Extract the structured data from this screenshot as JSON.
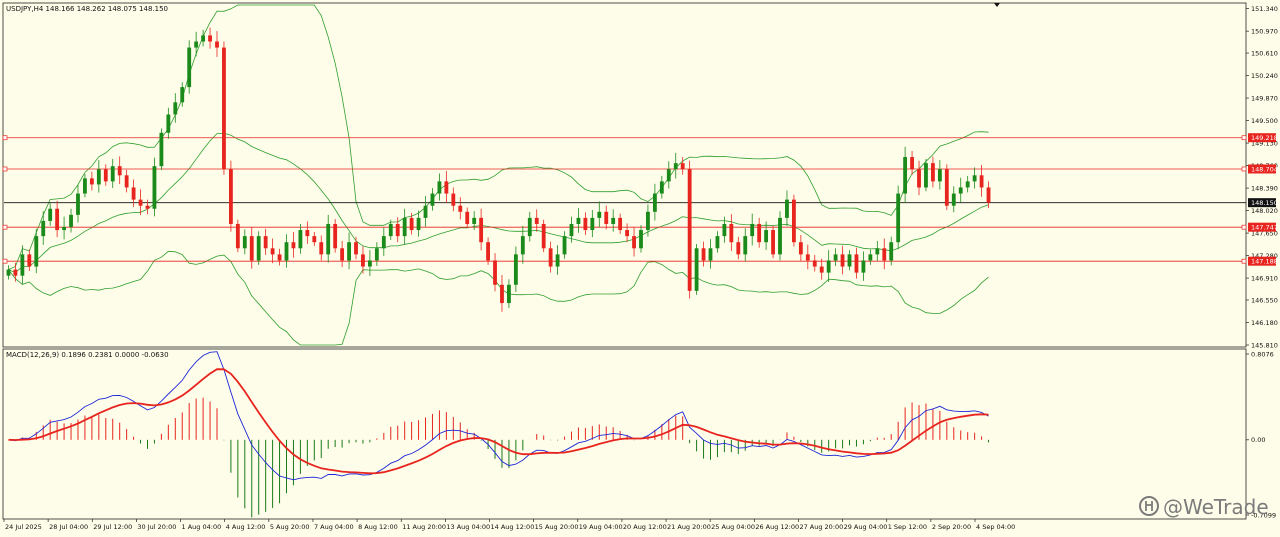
{
  "chart_data": [
    {
      "type": "candlestick",
      "title": "USDJPY,H4  148.166 148.262 148.075 148.150",
      "symbol": "USDJPY",
      "timeframe": "H4",
      "ohlc_readout": {
        "open": 148.166,
        "high": 148.262,
        "low": 148.075,
        "close": 148.15
      },
      "ylim": [
        145.81,
        151.4
      ],
      "y_ticks": [
        "151.340",
        "150.970",
        "150.610",
        "150.240",
        "149.870",
        "149.500",
        "149.130",
        "148.760",
        "148.390",
        "148.020",
        "147.650",
        "147.280",
        "146.910",
        "146.550",
        "146.180",
        "145.810"
      ],
      "x_ticks": [
        "24 Jul 2025",
        "28 Jul 04:00",
        "29 Jul 12:00",
        "30 Jul 20:00",
        "1 Aug 04:00",
        "4 Aug 12:00",
        "5 Aug 20:00",
        "7 Aug 04:00",
        "8 Aug 12:00",
        "11 Aug 20:00",
        "13 Aug 04:00",
        "14 Aug 12:00",
        "15 Aug 20:00",
        "19 Aug 04:00",
        "20 Aug 12:00",
        "21 Aug 20:00",
        "25 Aug 04:00",
        "26 Aug 12:00",
        "27 Aug 20:00",
        "29 Aug 04:00",
        "1 Sep 12:00",
        "2 Sep 20:00",
        "4 Sep 04:00"
      ],
      "horizontal_lines": [
        {
          "value": 149.218,
          "label": "149.218",
          "color": "#e8241f"
        },
        {
          "value": 148.704,
          "label": "148.704",
          "color": "#e8241f"
        },
        {
          "value": 147.747,
          "label": "147.747",
          "color": "#e8241f"
        },
        {
          "value": 147.188,
          "label": "147.188",
          "color": "#e8241f"
        }
      ],
      "current_price": {
        "value": 148.15,
        "label": "148.150"
      },
      "overlay": "Bollinger Bands",
      "bollinger_window": 20,
      "bollinger_k": 2,
      "closes": [
        147.05,
        146.95,
        147.3,
        147.1,
        147.6,
        147.85,
        148.05,
        147.7,
        147.75,
        147.95,
        148.3,
        148.55,
        148.45,
        148.7,
        148.5,
        148.75,
        148.6,
        148.4,
        148.2,
        148.1,
        148.05,
        148.75,
        149.3,
        149.6,
        149.8,
        150.05,
        150.7,
        150.8,
        150.9,
        150.8,
        150.7,
        148.7,
        147.8,
        147.4,
        147.6,
        147.2,
        147.6,
        147.4,
        147.3,
        147.2,
        147.5,
        147.4,
        147.7,
        147.6,
        147.5,
        147.3,
        147.8,
        147.4,
        147.2,
        147.5,
        147.3,
        147.1,
        147.2,
        147.4,
        147.6,
        147.8,
        147.6,
        147.9,
        147.7,
        147.9,
        148.1,
        148.3,
        148.5,
        148.3,
        148.1,
        148.0,
        147.8,
        147.9,
        147.5,
        147.2,
        146.8,
        146.5,
        146.8,
        147.3,
        147.6,
        147.9,
        147.8,
        147.4,
        147.1,
        147.3,
        147.6,
        147.8,
        147.9,
        147.7,
        147.9,
        148.0,
        147.8,
        147.9,
        147.7,
        147.6,
        147.4,
        147.7,
        148.0,
        148.3,
        148.5,
        148.7,
        148.8,
        148.7,
        146.7,
        147.4,
        147.2,
        147.4,
        147.6,
        147.8,
        147.5,
        147.3,
        147.6,
        147.8,
        147.5,
        147.7,
        147.3,
        147.9,
        148.2,
        147.5,
        147.3,
        147.2,
        147.1,
        147.0,
        147.2,
        147.3,
        147.1,
        147.3,
        147.0,
        147.2,
        147.3,
        147.4,
        147.2,
        147.5,
        148.3,
        148.9,
        148.7,
        148.4,
        148.8,
        148.5,
        148.7,
        148.1,
        148.3,
        148.4,
        148.5,
        148.6,
        148.4,
        148.15
      ],
      "y2label": "MACD(12,26,9) 0.1896 0.2381 0.0000 -0.0630",
      "indicator": {
        "name": "MACD",
        "params": [
          12,
          26,
          9
        ],
        "readout": [
          0.1896,
          0.2381,
          0.0,
          -0.063
        ],
        "ylim": [
          -0.7099,
          0.8076
        ],
        "y_ticks": [
          "0.8076",
          "0.00",
          "-0.7099"
        ],
        "series": [
          {
            "name": "histogram",
            "color_up": "#e8241f",
            "color_down": "#1a7a1a"
          },
          {
            "name": "MACD",
            "color": "#1d27d8"
          },
          {
            "name": "Signal",
            "color": "#e8241f"
          }
        ]
      }
    }
  ],
  "watermark": {
    "text": "@WeTrade",
    "icon": "wetrade-logo-icon"
  },
  "colors": {
    "bull": "#1a8a1a",
    "bear": "#e8241f",
    "band": "#2e9e2e",
    "background": "#fefde9"
  }
}
